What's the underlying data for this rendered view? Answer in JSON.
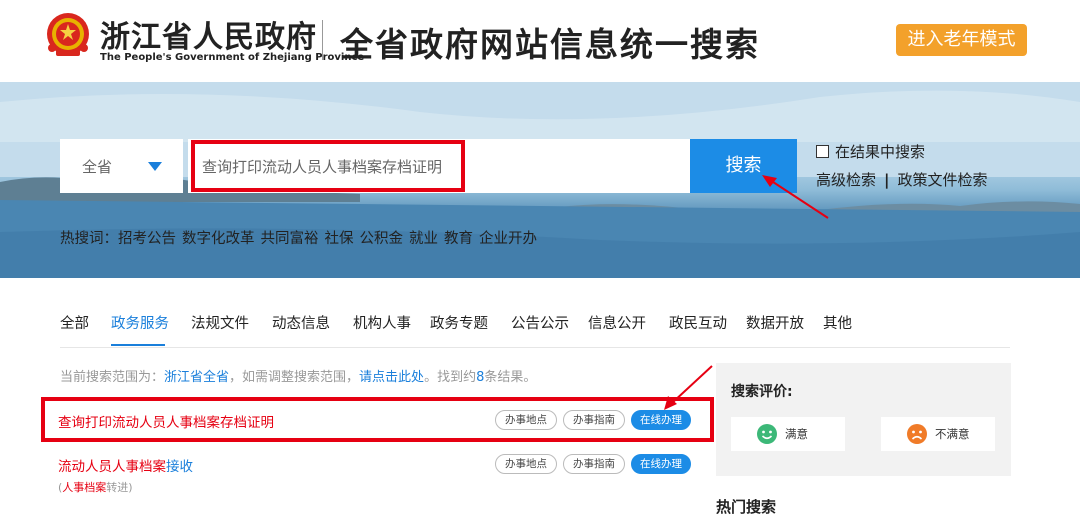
{
  "header": {
    "site_name": "浙江省人民政府",
    "site_name_en": "The People's Government of Zhejiang Province",
    "page_heading": "全省政府网站信息统一搜索",
    "elder_mode_label": "进入老年模式"
  },
  "search": {
    "scope_label": "全省",
    "input_value": "查询打印流动人员人事档案存档证明",
    "button_label": "搜索",
    "in_results_label": "在结果中搜索",
    "advanced_label": "高级检索",
    "separator": "|",
    "policy_label": "政策文件检索",
    "hot_prefix": "热搜词：",
    "hot_words": [
      "招考公告",
      "数字化改革",
      "共同富裕",
      "社保",
      "公积金",
      "就业",
      "教育",
      "企业开办"
    ]
  },
  "tabs": [
    "全部",
    "政务服务",
    "法规文件",
    "动态信息",
    "机构人事",
    "政务专题",
    "公告公示",
    "信息公开",
    "政民互动",
    "数据开放",
    "其他"
  ],
  "active_tab": "政务服务",
  "scope_note": {
    "prefix": "当前搜索范围为：",
    "scope": "浙江省全省",
    "middle": "，如需调整搜索范围，",
    "link": "请点击此处",
    "found_prefix": "。找到约",
    "count": "8",
    "found_suffix": "条结果。"
  },
  "results": [
    {
      "title": "查询打印流动人员人事档案存档证明",
      "buttons": [
        "办事地点",
        "办事指南",
        "在线办理"
      ]
    },
    {
      "title_red": "流动人员人事档案",
      "title_blue": "接收",
      "sub_open": "(",
      "sub_red": "人事档案",
      "sub_grey": "转进)",
      "buttons": [
        "办事地点",
        "办事指南",
        "在线办理"
      ]
    }
  ],
  "side": {
    "rating_title": "搜索评价:",
    "satisfied": "满意",
    "unsatisfied": "不满意",
    "bottom_heading": "热门搜索"
  },
  "colors": {
    "accent_blue": "#1c8ce6",
    "highlight_red": "#e60012",
    "elder_orange": "#f3a12b",
    "happy_green": "#3cb878",
    "sad_orange": "#f07b28"
  }
}
